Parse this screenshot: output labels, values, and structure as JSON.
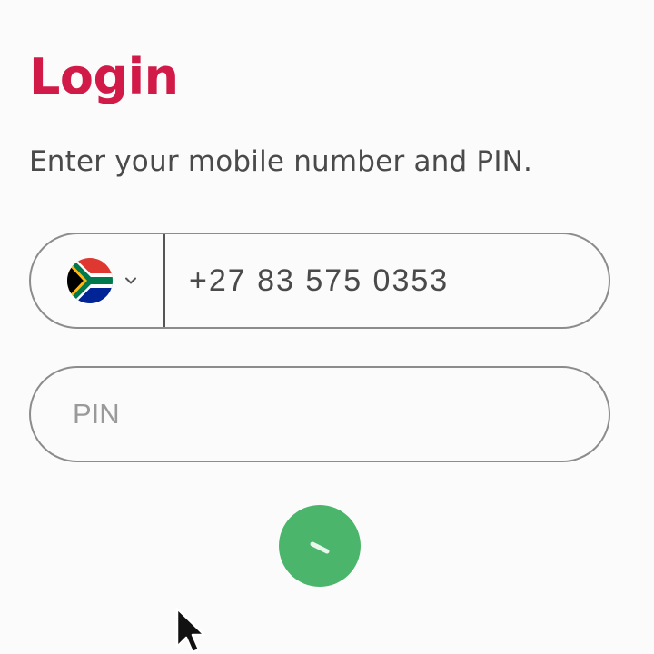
{
  "colors": {
    "title": "#d11a47",
    "accent_button": "#4cb56c",
    "spinner": "#e9f6ec"
  },
  "login": {
    "title": "Login",
    "subtitle": "Enter your mobile number and PIN."
  },
  "phone": {
    "country_flag_icon": "south-africa-flag-icon",
    "dropdown_icon": "chevron-down-icon",
    "value": "+27 83 575 0353"
  },
  "pin": {
    "placeholder": "PIN",
    "value": ""
  },
  "submit": {
    "state": "loading",
    "icon": "spinner-icon"
  },
  "mouse_cursor": {
    "icon": "arrow-cursor-icon"
  }
}
